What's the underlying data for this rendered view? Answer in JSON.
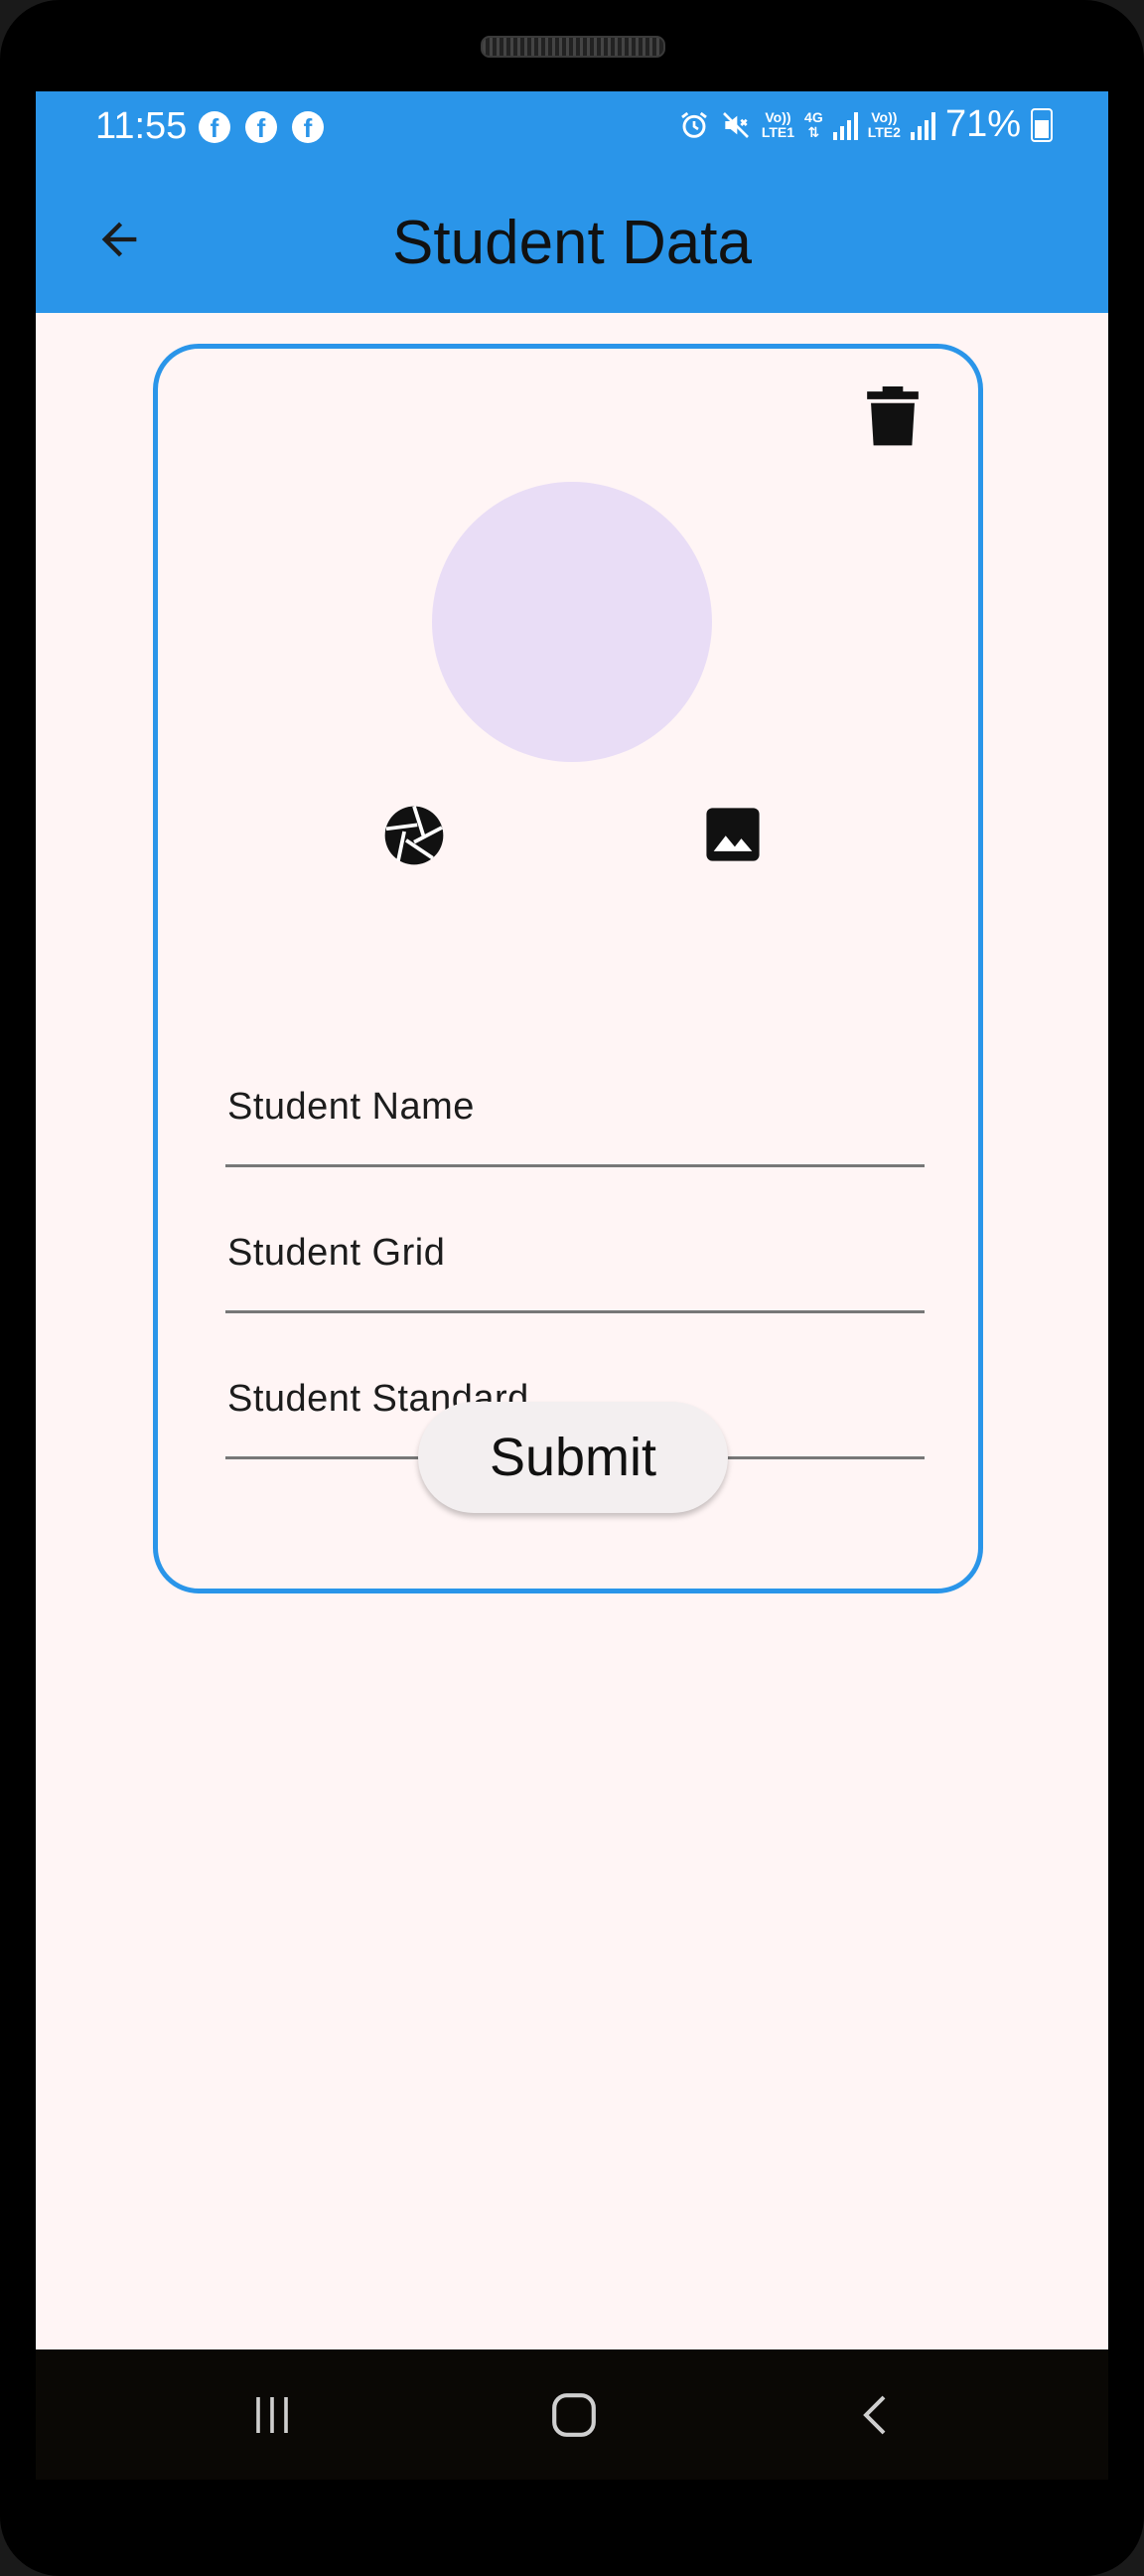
{
  "status_bar": {
    "time": "11:55",
    "notification_icons": [
      "facebook-icon",
      "facebook-icon",
      "facebook-icon"
    ],
    "network_1": {
      "top": "Vo))",
      "bottom": "LTE1"
    },
    "network_type": "4G",
    "network_2": {
      "top": "Vo))",
      "bottom": "LTE2"
    },
    "battery": "71%"
  },
  "app_bar": {
    "title": "Student Data",
    "back_icon": "arrow-back-icon"
  },
  "form": {
    "delete_icon": "delete-icon",
    "camera_icon": "camera-shutter-icon",
    "gallery_icon": "image-icon",
    "fields": [
      {
        "label": "Student Name",
        "value": ""
      },
      {
        "label": "Student Grid",
        "value": ""
      },
      {
        "label": "Student Standard",
        "value": ""
      }
    ],
    "submit_label": "Submit"
  },
  "nav_bar": {
    "buttons": [
      "recent-apps-icon",
      "home-icon",
      "back-icon"
    ]
  },
  "colors": {
    "primary": "#2a95e9",
    "background": "#fff5f5",
    "avatar": "#e9ddf6",
    "button": "#f3eff0"
  }
}
